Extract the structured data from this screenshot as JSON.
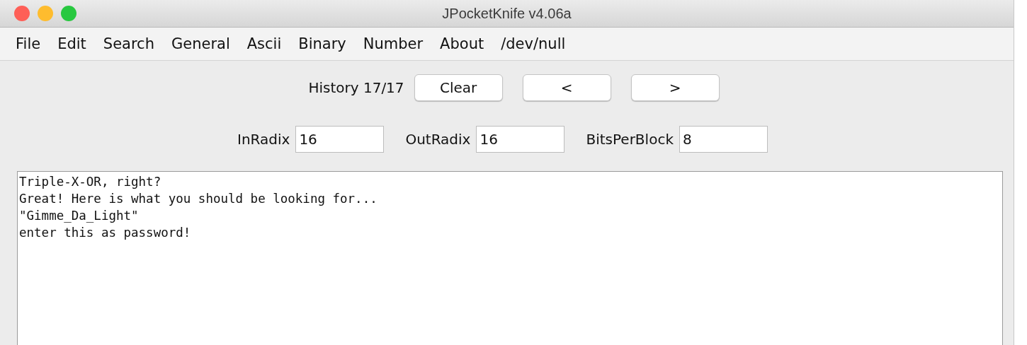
{
  "window": {
    "title": "JPocketKnife v4.06a"
  },
  "menu": [
    "File",
    "Edit",
    "Search",
    "General",
    "Ascii",
    "Binary",
    "Number",
    "About",
    "/dev/null"
  ],
  "history": {
    "label": "History 17/17",
    "buttons": [
      "Clear",
      "<",
      ">"
    ]
  },
  "radix_fields": [
    {
      "label": "InRadix",
      "value": "16"
    },
    {
      "label": "OutRadix",
      "value": "16"
    },
    {
      "label": "BitsPerBlock",
      "value": "8"
    }
  ],
  "output_lines": [
    "Triple-X-OR, right?",
    "Great! Here is what you should be looking for...",
    "\"Gimme_Da_Light\"",
    "enter this as password!"
  ]
}
